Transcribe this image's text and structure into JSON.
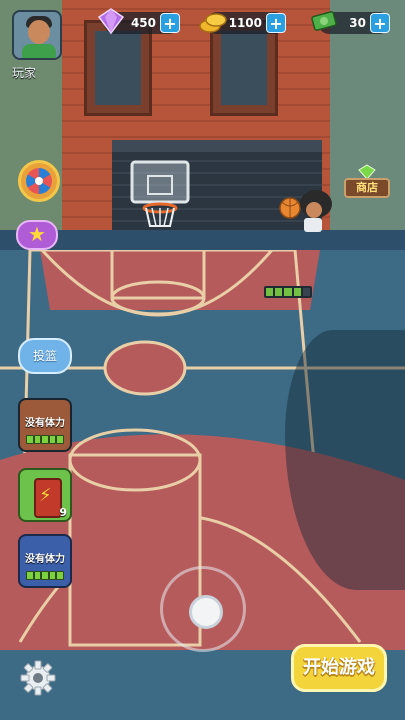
{
  "player": {
    "label": "玩家"
  },
  "currencies": {
    "gems": {
      "value": "450",
      "icon": "gem-icon"
    },
    "coins": {
      "value": "1100",
      "icon": "coin-icon"
    },
    "cash": {
      "value": "30",
      "icon": "cash-icon"
    }
  },
  "buttons": {
    "shoot_label": "投篮",
    "shop_label": "商店",
    "start_label": "开始游戏"
  },
  "skills": {
    "slot1_label": "没有体力",
    "slot2_count": "9",
    "slot3_label": "没有体力"
  },
  "colors": {
    "court_red": "#b65b5c",
    "court_blue": "#3d6a84",
    "accent_yellow": "#f3d43b",
    "accent_blue": "#2aa0e0"
  }
}
